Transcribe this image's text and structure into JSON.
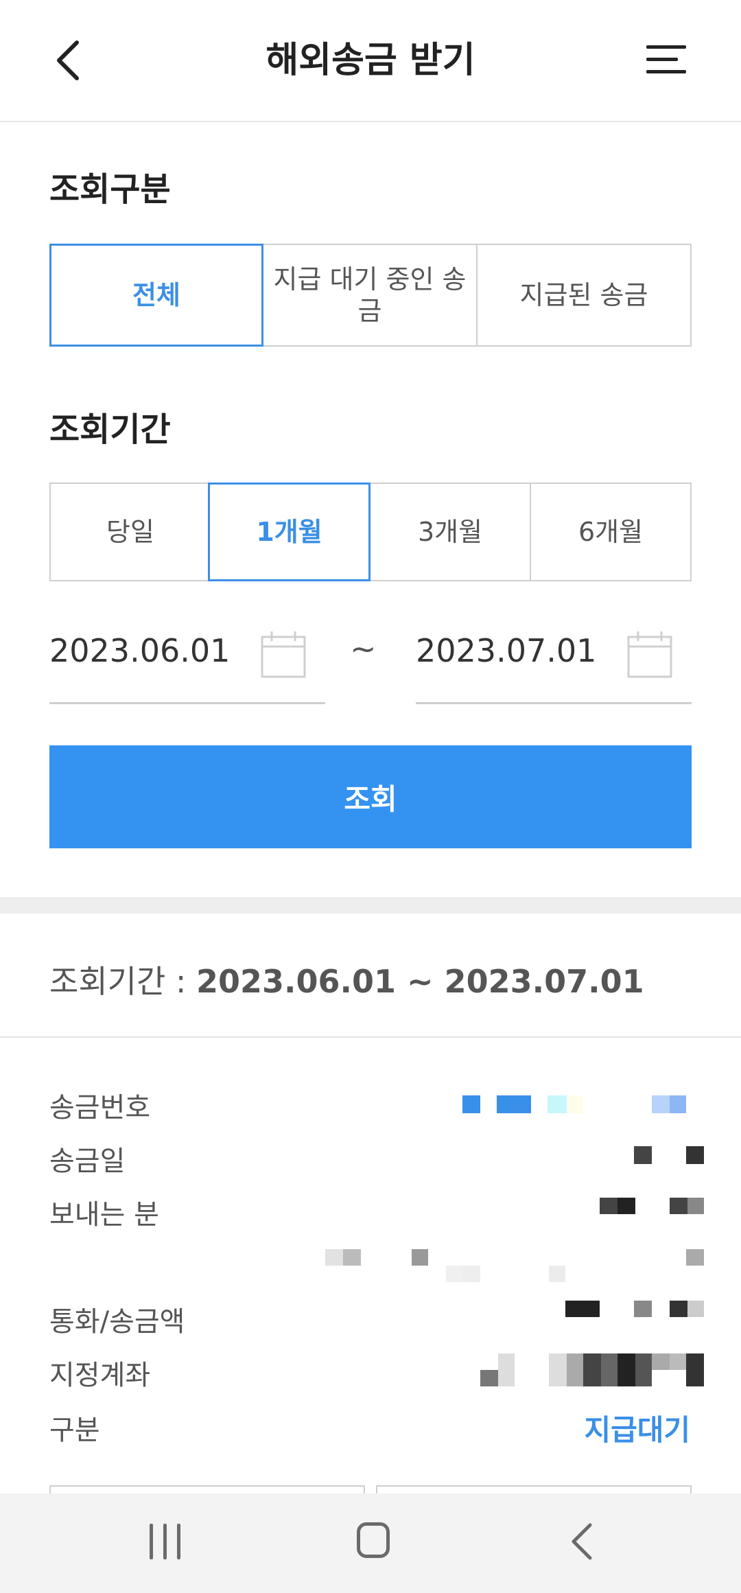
{
  "header": {
    "title": "해외송금 받기",
    "back_icon": "chevron-left-icon",
    "menu_icon": "hamburger-menu-icon"
  },
  "inquiry_type": {
    "label": "조회구분",
    "options": [
      "전체",
      "지급 대기 중인 송금",
      "지급된 송금"
    ],
    "selected": "전체"
  },
  "inquiry_period": {
    "label": "조회기간",
    "options": [
      "당일",
      "1개월",
      "3개월",
      "6개월"
    ],
    "selected": "1개월",
    "start_date": "2023.06.01",
    "end_date": "2023.07.01",
    "separator": "~",
    "calendar_icon": "calendar-icon"
  },
  "search_button": {
    "label": "조회"
  },
  "result": {
    "period_label": "조회기간 : ",
    "period_value": "2023.06.01 ~ 2023.07.01",
    "rows": [
      {
        "label": "송금번호"
      },
      {
        "label": "송금일"
      },
      {
        "label": "보내는 분"
      },
      {
        "label": "통화/송금액"
      },
      {
        "label": "지정계좌"
      },
      {
        "label": "구분",
        "value": "지급대기"
      }
    ]
  },
  "colors": {
    "accent": "#3b8fe6",
    "button": "#3493f1",
    "border": "#cfcfcf"
  },
  "navbar": {
    "recent_icon": "recent-apps-icon",
    "home_icon": "home-icon",
    "back_icon": "back-icon"
  }
}
